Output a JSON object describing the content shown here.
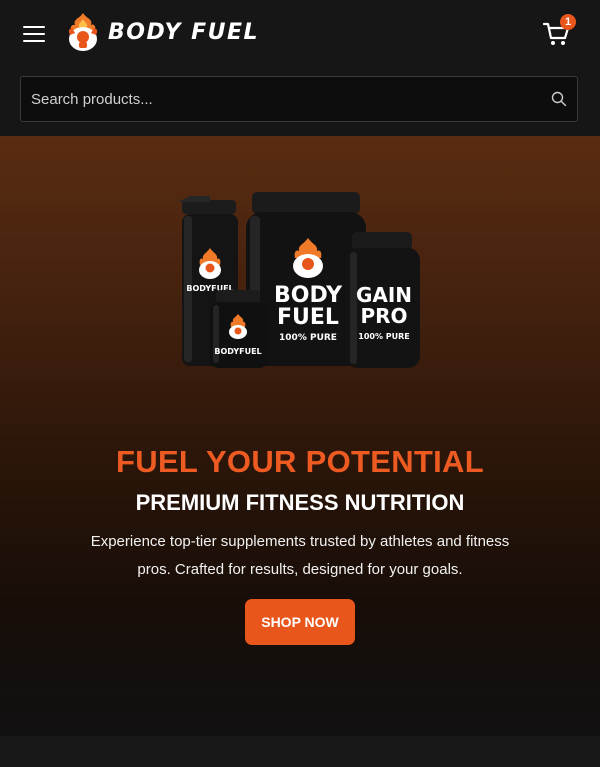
{
  "brand": {
    "name": "BODY FUEL"
  },
  "header": {
    "cart_count": "1",
    "search_placeholder": "Search products..."
  },
  "hero": {
    "title": "FUEL YOUR POTENTIAL",
    "subtitle": "PREMIUM FITNESS NUTRITION",
    "description": "Experience top-tier supplements trusted by athletes and fitness pros. Crafted for results, designed for your goals.",
    "cta_label": "SHOP NOW",
    "products": {
      "shaker_label": "BODYFUEL",
      "small_jar_label": "BODYFUEL",
      "main_jar_line1": "BODY",
      "main_jar_line2": "FUEL",
      "main_jar_tag": "100% PURE",
      "gain_jar_line1": "GAIN",
      "gain_jar_line2": "PRO",
      "gain_jar_tag": "100% PURE"
    }
  },
  "colors": {
    "accent": "#e8561b",
    "headline": "#ee5b22",
    "header_bg": "#161616",
    "page_bg": "#111111"
  },
  "icons": [
    "menu-icon",
    "flame-muscle-logo-icon",
    "cart-icon",
    "search-icon"
  ]
}
